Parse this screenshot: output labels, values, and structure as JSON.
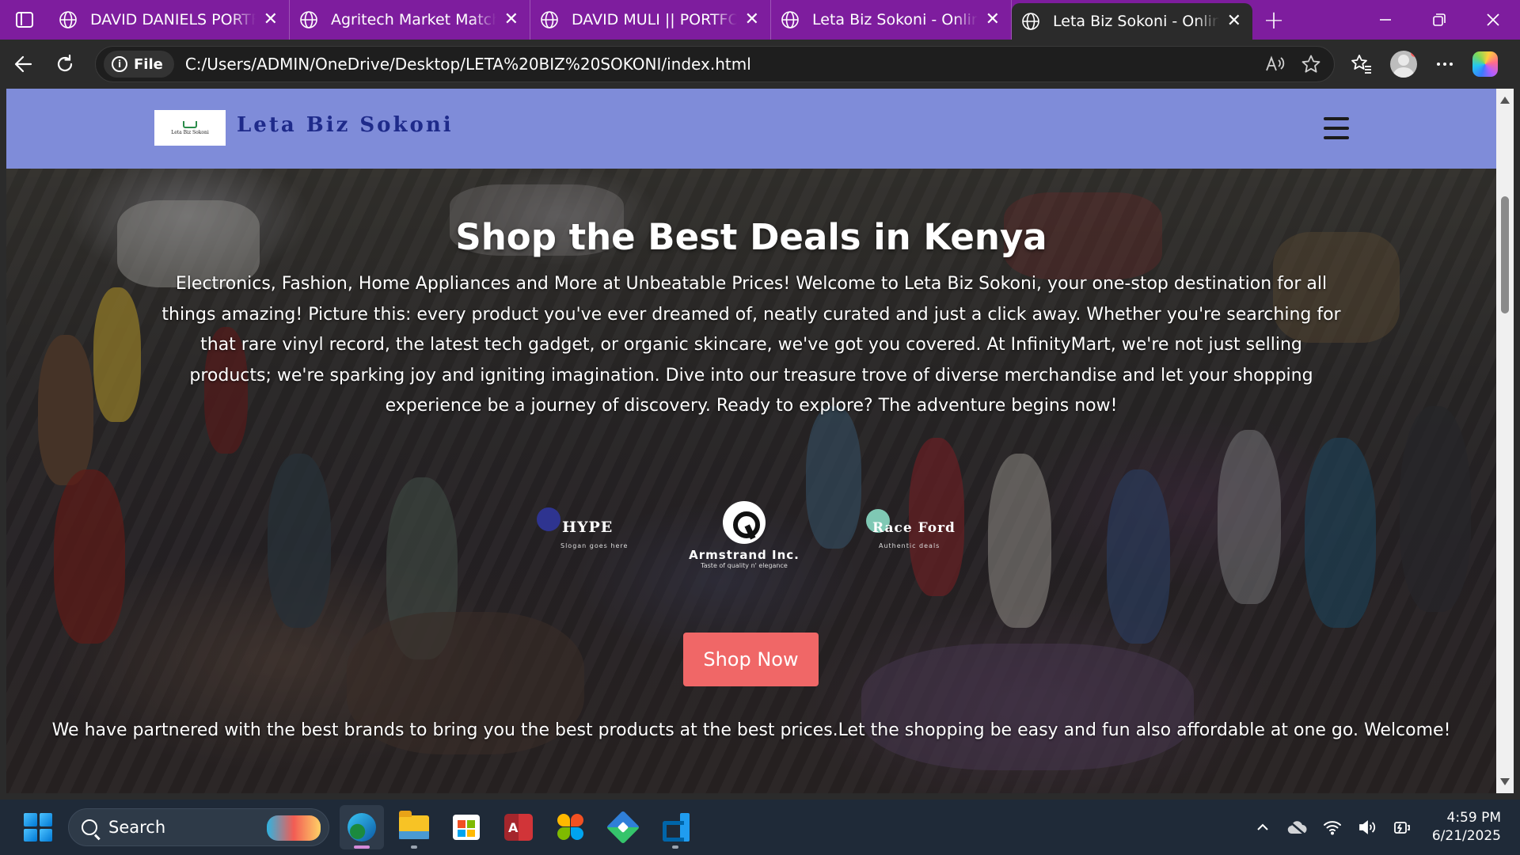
{
  "browser": {
    "tabs": [
      {
        "title": "DAVID DANIELS PORTFOLIO",
        "active": false
      },
      {
        "title": "Agritech Market Match",
        "active": false
      },
      {
        "title": "DAVID MULI || PORTFOLIO",
        "active": false
      },
      {
        "title": "Leta Biz Sokoni - Online Shop",
        "active": false
      },
      {
        "title": "Leta Biz Sokoni - Online Shop",
        "active": true
      }
    ],
    "new_tab": "+",
    "site_info_label": "File",
    "url": "C:/Users/ADMIN/OneDrive/Desktop/LETA%20BIZ%20SOKONI/index.html"
  },
  "site": {
    "logo_mini_text": "Leta Biz Sokoni",
    "brand_name": "Leta Biz Sokoni",
    "header_color": "#7f8cd9",
    "brand_color": "#1e2a8a"
  },
  "hero": {
    "title": "Shop the Best Deals in Kenya",
    "description": "Electronics, Fashion, Home Appliances and More at Unbeatable Prices! Welcome to Leta Biz Sokoni, your one-stop destination for all things amazing! Picture this: every product you've ever dreamed of, neatly curated and just a click away. Whether you're searching for that rare vinyl record, the latest tech gadget, or organic skincare, we've got you covered. At InfinityMart, we're not just selling products; we're sparking joy and igniting imagination. Dive into our treasure trove of diverse merchandise and let your shopping experience be a journey of discovery. Ready to explore? The adventure begins now!",
    "partners": [
      {
        "name": "HYPE",
        "tagline": "Slogan goes here"
      },
      {
        "name": "Armstrand Inc.",
        "tagline": "Taste of quality n' elegance"
      },
      {
        "name": "Race Ford",
        "tagline": "Authentic deals"
      }
    ],
    "cta_label": "Shop Now",
    "cta_color": "#f06767",
    "footer_text": "We have partnered with the best brands to bring you the best products at the best prices.Let the shopping be easy and fun also affordable at one go. Welcome!"
  },
  "taskbar": {
    "search_label": "Search",
    "time": "4:59 PM",
    "date": "6/21/2025"
  }
}
